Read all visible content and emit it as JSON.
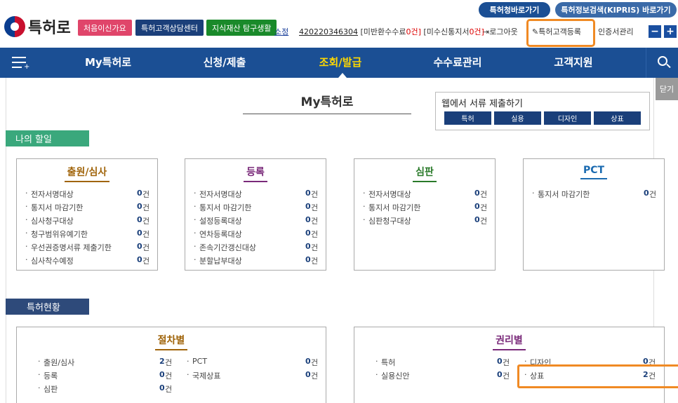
{
  "header": {
    "logo_text": "특허로",
    "btn_first_visit": "처음이신가요",
    "btn_call_center": "특허고객상담센터",
    "btn_ip_explore": "지식재산 탐구생활",
    "top_kipo": "특허청바로가기",
    "top_kipris": "특허정보검색(KIPRIS) 바로가기",
    "affiliation": "소정",
    "customer_no": "420220346304",
    "unpaid_refund_label": "[미반환수수료",
    "unpaid_refund_value": "0건]",
    "unread_notice_label": "[미수신통지서",
    "unread_notice_value": "0건]",
    "logout": "로그아웃",
    "register": "특허고객등록",
    "cert_manage": "인증서관리",
    "zoom_out": "−",
    "zoom_in": "+"
  },
  "nav": {
    "items": [
      "My특허로",
      "신청/제출",
      "조회/발급",
      "수수료관리",
      "고객지원"
    ],
    "active_index": 2
  },
  "page": {
    "title": "My특허로",
    "close": "닫기"
  },
  "web_submit": {
    "title": "웹에서 서류 제출하기",
    "buttons": [
      "특허",
      "실용",
      "디자인",
      "상표"
    ]
  },
  "todo": {
    "label": "나의 할일",
    "cards": [
      {
        "title": "출원/심사",
        "color": "#a0640a",
        "items": [
          {
            "label": "전자서명대상",
            "count": "0",
            "unit": "건"
          },
          {
            "label": "통지서 마감기한",
            "count": "0",
            "unit": "건"
          },
          {
            "label": "심사청구대상",
            "count": "0",
            "unit": "건"
          },
          {
            "label": "청구범위유예기한",
            "count": "0",
            "unit": "건"
          },
          {
            "label": "우선권증명서류 제출기한",
            "count": "0",
            "unit": "건"
          },
          {
            "label": "심사착수예정",
            "count": "0",
            "unit": "건"
          }
        ]
      },
      {
        "title": "등록",
        "color": "#7a2a7a",
        "items": [
          {
            "label": "전자서명대상",
            "count": "0",
            "unit": "건"
          },
          {
            "label": "통지서 마감기한",
            "count": "0",
            "unit": "건"
          },
          {
            "label": "설정등록대상",
            "count": "0",
            "unit": "건"
          },
          {
            "label": "연차등록대상",
            "count": "0",
            "unit": "건"
          },
          {
            "label": "존속기간갱신대상",
            "count": "0",
            "unit": "건"
          },
          {
            "label": "분할납부대상",
            "count": "0",
            "unit": "건"
          }
        ]
      },
      {
        "title": "심판",
        "color": "#2a7a2a",
        "items": [
          {
            "label": "전자서명대상",
            "count": "0",
            "unit": "건"
          },
          {
            "label": "통지서 마감기한",
            "count": "0",
            "unit": "건"
          },
          {
            "label": "심판청구대상",
            "count": "0",
            "unit": "건"
          }
        ]
      },
      {
        "title": "PCT",
        "color": "#1a6ab0",
        "items": [
          {
            "label": "통지서 마감기한",
            "count": "0",
            "unit": "건"
          }
        ]
      }
    ]
  },
  "status": {
    "label": "특허현황",
    "by_procedure": {
      "title": "절차별",
      "left": [
        {
          "label": "출원/심사",
          "count": "2",
          "unit": "건"
        },
        {
          "label": "등록",
          "count": "0",
          "unit": "건"
        },
        {
          "label": "심판",
          "count": "0",
          "unit": "건"
        }
      ],
      "right": [
        {
          "label": "PCT",
          "count": "0",
          "unit": "건"
        },
        {
          "label": "국제상표",
          "count": "0",
          "unit": "건"
        }
      ]
    },
    "by_right": {
      "title": "권리별",
      "left": [
        {
          "label": "특허",
          "count": "0",
          "unit": "건"
        },
        {
          "label": "실용신안",
          "count": "0",
          "unit": "건"
        }
      ],
      "right": [
        {
          "label": "디자인",
          "count": "0",
          "unit": "건"
        },
        {
          "label": "상표",
          "count": "2",
          "unit": "건"
        }
      ]
    }
  },
  "colors": {
    "nav_bg": "#1b4f94",
    "active": "#ffd800",
    "highlight": "#f08a24",
    "green_label": "#3aa87c",
    "navy_label": "#2e4a7a"
  }
}
